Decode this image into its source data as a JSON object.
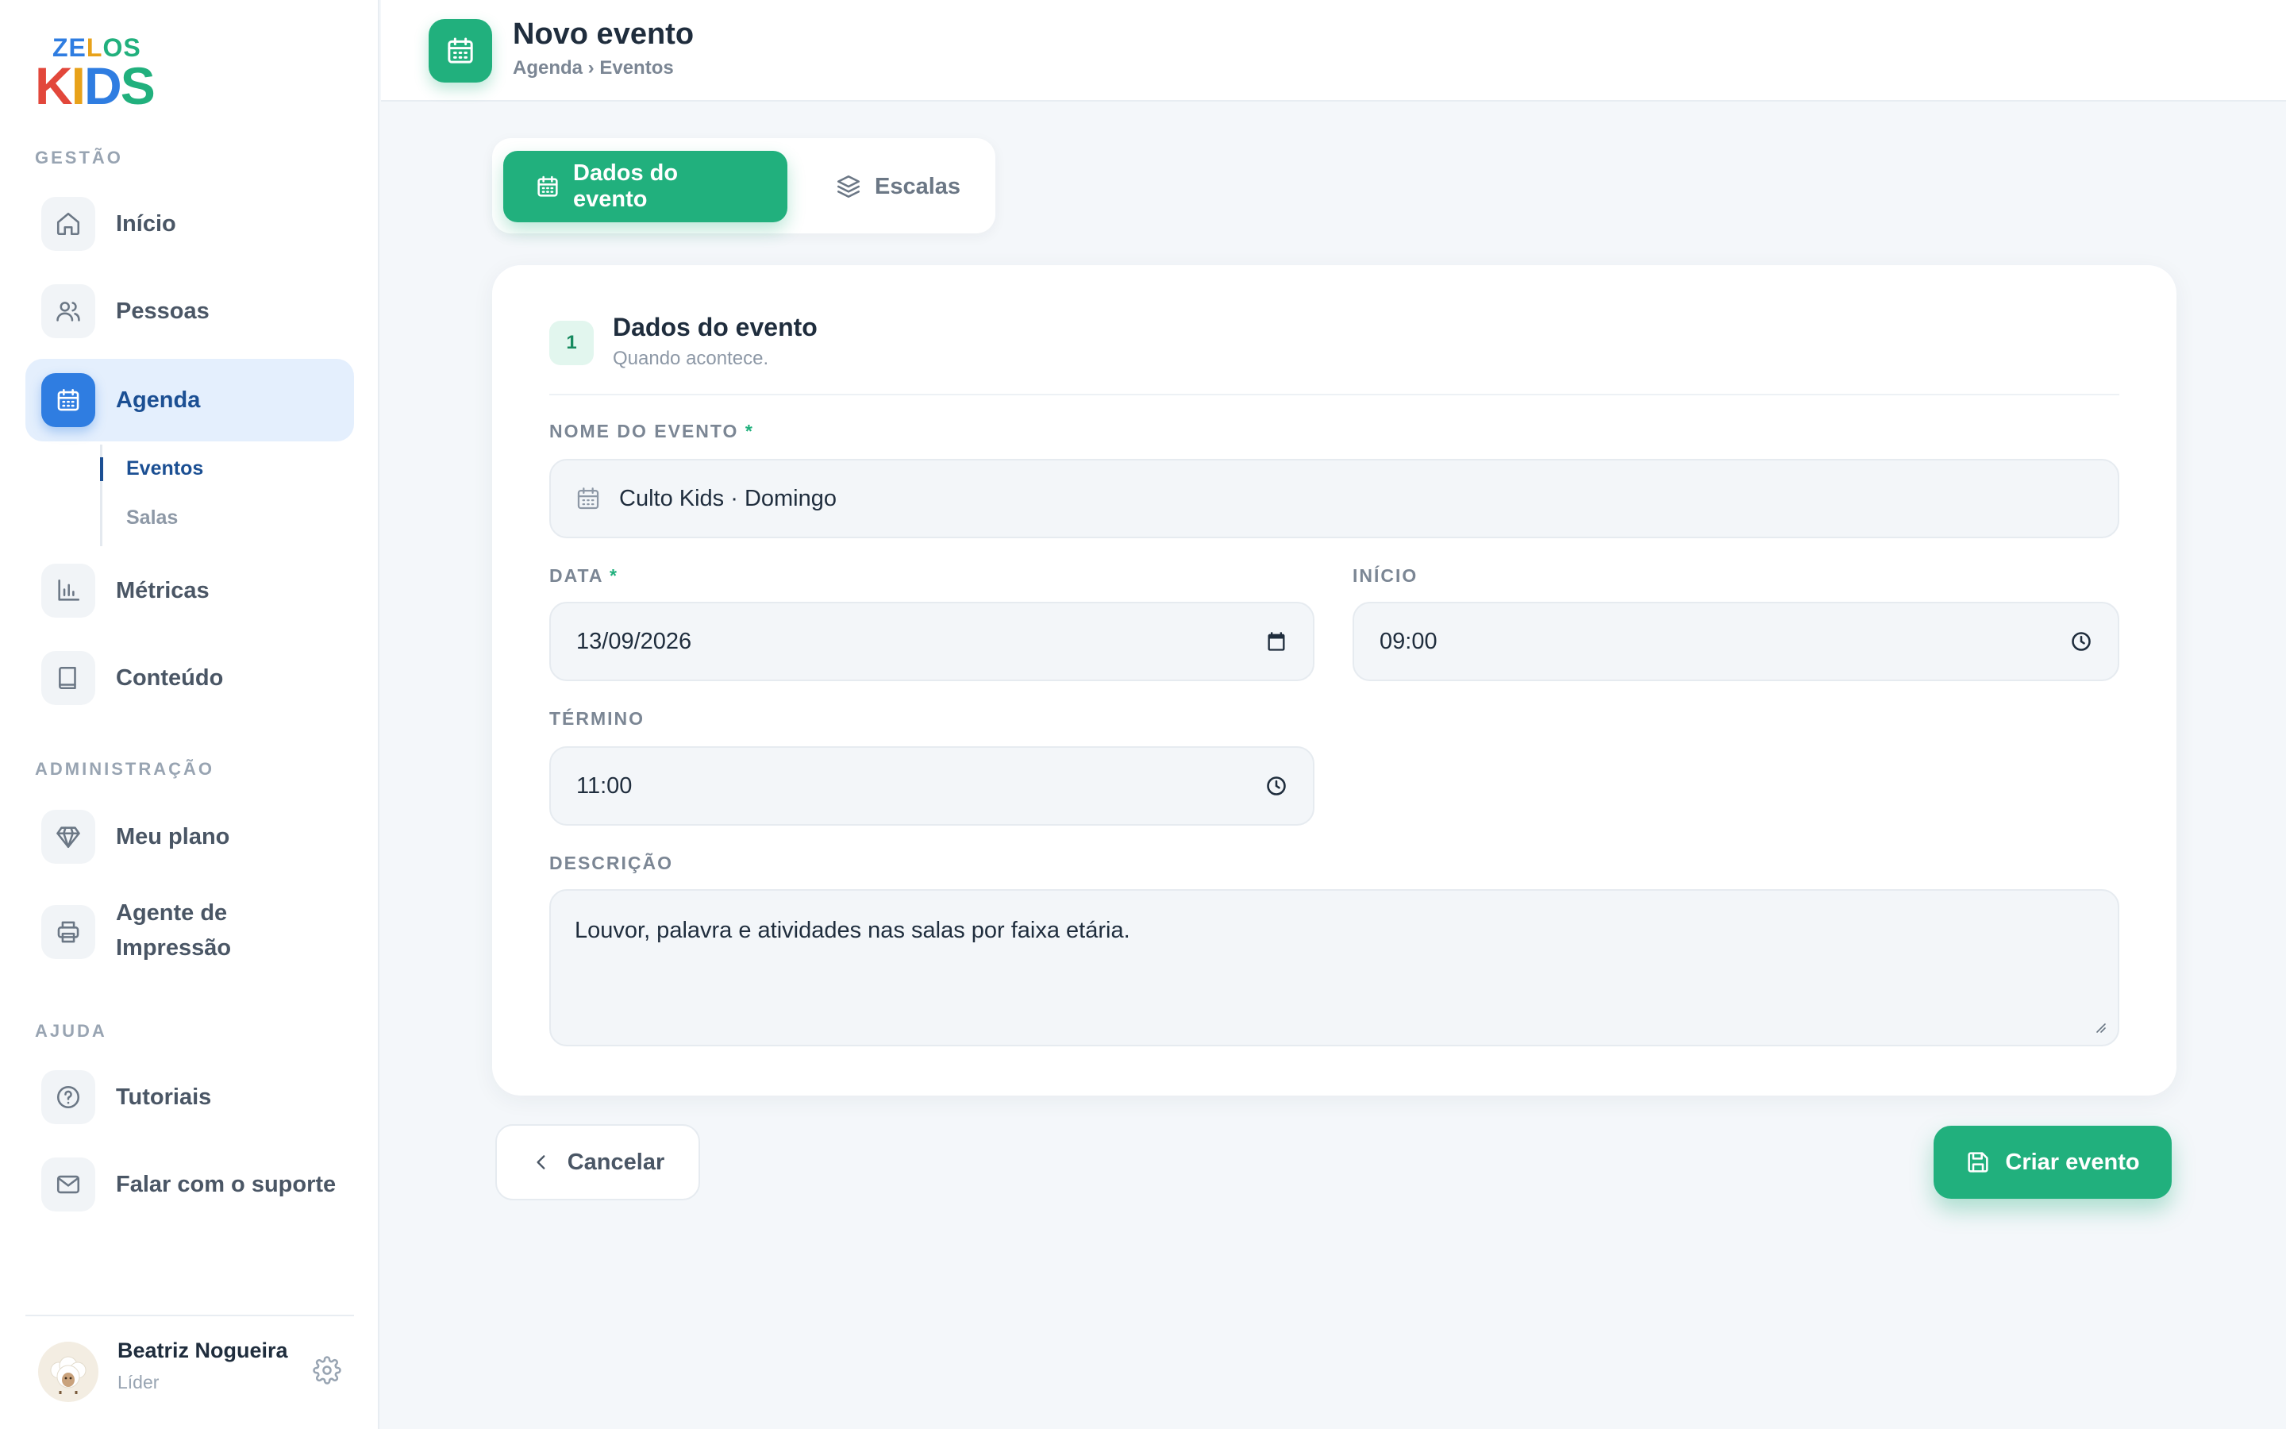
{
  "app": {
    "logo_top": "ZELOS",
    "logo_bottom": "KIDS"
  },
  "colors": {
    "brand_green": "#21b07d",
    "brand_blue": "#2f7de1",
    "active_nav_bg": "#e4effd"
  },
  "sidebar": {
    "sections": {
      "gestao": "GESTÃO",
      "administracao": "ADMINISTRAÇÃO",
      "ajuda": "AJUDA"
    },
    "items": {
      "inicio": {
        "label": "Início",
        "icon": "home-icon"
      },
      "pessoas": {
        "label": "Pessoas",
        "icon": "users-icon"
      },
      "agenda": {
        "label": "Agenda",
        "icon": "calendar-icon"
      },
      "metricas": {
        "label": "Métricas",
        "icon": "bar-chart-icon"
      },
      "conteudo": {
        "label": "Conteúdo",
        "icon": "book-icon"
      },
      "meu_plano": {
        "label": "Meu plano",
        "icon": "diamond-icon"
      },
      "agente_impressao_l1": "Agente de",
      "agente_impressao_l2": "Impressão",
      "tutoriais": {
        "label": "Tutoriais",
        "icon": "help-circle-icon"
      },
      "suporte": {
        "label": "Falar com o suporte",
        "icon": "mail-icon"
      }
    },
    "subnav": {
      "eventos": "Eventos",
      "salas": "Salas"
    },
    "user": {
      "name": "Beatriz Nogueira",
      "role": "Líder"
    }
  },
  "header": {
    "title": "Novo evento",
    "breadcrumb": "Agenda › Eventos"
  },
  "tabs": {
    "dados": "Dados do evento",
    "escalas": "Escalas"
  },
  "form": {
    "step": "1",
    "title": "Dados do evento",
    "subtitle": "Quando acontece.",
    "nome_label": "NOME DO EVENTO",
    "nome_value": "Culto Kids · Domingo",
    "data_label": "DATA",
    "data_value": "13/09/2026",
    "inicio_label": "INÍCIO",
    "inicio_value": "09:00",
    "termino_label": "TÉRMINO",
    "termino_value": "11:00",
    "descricao_label": "DESCRIÇÃO",
    "descricao_value": "Louvor, palavra e atividades nas salas por faixa etária.",
    "required_mark": "*"
  },
  "actions": {
    "cancel": "Cancelar",
    "create": "Criar evento"
  }
}
